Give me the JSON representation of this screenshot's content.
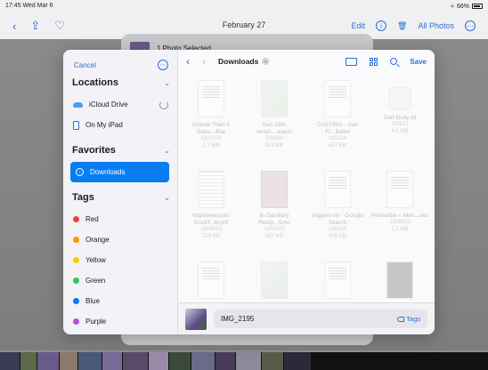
{
  "status_bar": {
    "time_date": "17:45  Wed Mar 6",
    "battery": "66%"
  },
  "photos_bar": {
    "title": "February 27",
    "edit_label": "Edit",
    "info_glyph": "i",
    "all_photos_label": "All Photos",
    "more_glyph": "⋯"
  },
  "share_sheet": {
    "header": "1 Photo Selected"
  },
  "sidebar": {
    "cancel_label": "Cancel",
    "more_glyph": "⋯",
    "locations_heading": "Locations",
    "locations": [
      {
        "label": "iCloud Drive",
        "icon": "cloud-icon"
      },
      {
        "label": "On My iPad",
        "icon": "ipad-icon"
      }
    ],
    "favorites_heading": "Favorites",
    "favorites": [
      {
        "label": "Downloads",
        "icon": "clock-icon",
        "selected": true
      }
    ],
    "tags_heading": "Tags",
    "tags": [
      {
        "label": "Red",
        "color": "#ff3b30"
      },
      {
        "label": "Orange",
        "color": "#ff9500"
      },
      {
        "label": "Yellow",
        "color": "#ffcc00"
      },
      {
        "label": "Green",
        "color": "#34c759"
      },
      {
        "label": "Blue",
        "color": "#007aff"
      },
      {
        "label": "Purple",
        "color": "#af52de"
      }
    ]
  },
  "toolbar": {
    "back_glyph": "‹",
    "forward_glyph": "›",
    "location": "Downloads",
    "save_label": "Save"
  },
  "files": [
    {
      "name": "Amtrak Train 5 Statu...iRat",
      "meta1": "10/01/23",
      "meta2": "1.7 MB",
      "thumb": "doc"
    },
    {
      "name": "burt 19th street....earch",
      "meta1": "7/28/23",
      "meta2": "922 KB",
      "thumb": "map"
    },
    {
      "name": "CASTING - San Fr...Ballet",
      "meta1": "2/02/24",
      "meta2": "627 KB",
      "thumb": "doc"
    },
    {
      "name": "Dart Body.stl",
      "meta1": "7/03/21",
      "meta2": "4.2 MB",
      "thumb": "device"
    },
    {
      "name": "httpswww.paci ficsurf...le.pdf",
      "meta1": "12/08/23",
      "meta2": "220 KB",
      "thumb": "sheet"
    },
    {
      "name": "In-Sandiary Recip...Smo",
      "meta1": "11/05/23",
      "meta2": "857 KB",
      "thumb": "red"
    },
    {
      "name": "origami iris - Google Search",
      "meta1": "1/26/24",
      "meta2": "305 KB",
      "thumb": "doc"
    },
    {
      "name": "Poinsettia – Mon...ues",
      "meta1": "12/06/23",
      "meta2": "2.1 MB",
      "thumb": "doc"
    },
    {
      "name": "",
      "meta1": "",
      "meta2": "",
      "thumb": "doc"
    },
    {
      "name": "",
      "meta1": "",
      "meta2": "",
      "thumb": "map"
    },
    {
      "name": "",
      "meta1": "",
      "meta2": "",
      "thumb": "doc"
    },
    {
      "name": "",
      "meta1": "",
      "meta2": "",
      "thumb": "gray"
    }
  ],
  "bottom_bar": {
    "filename": "IMG_2195",
    "tags_label": "Tags"
  }
}
